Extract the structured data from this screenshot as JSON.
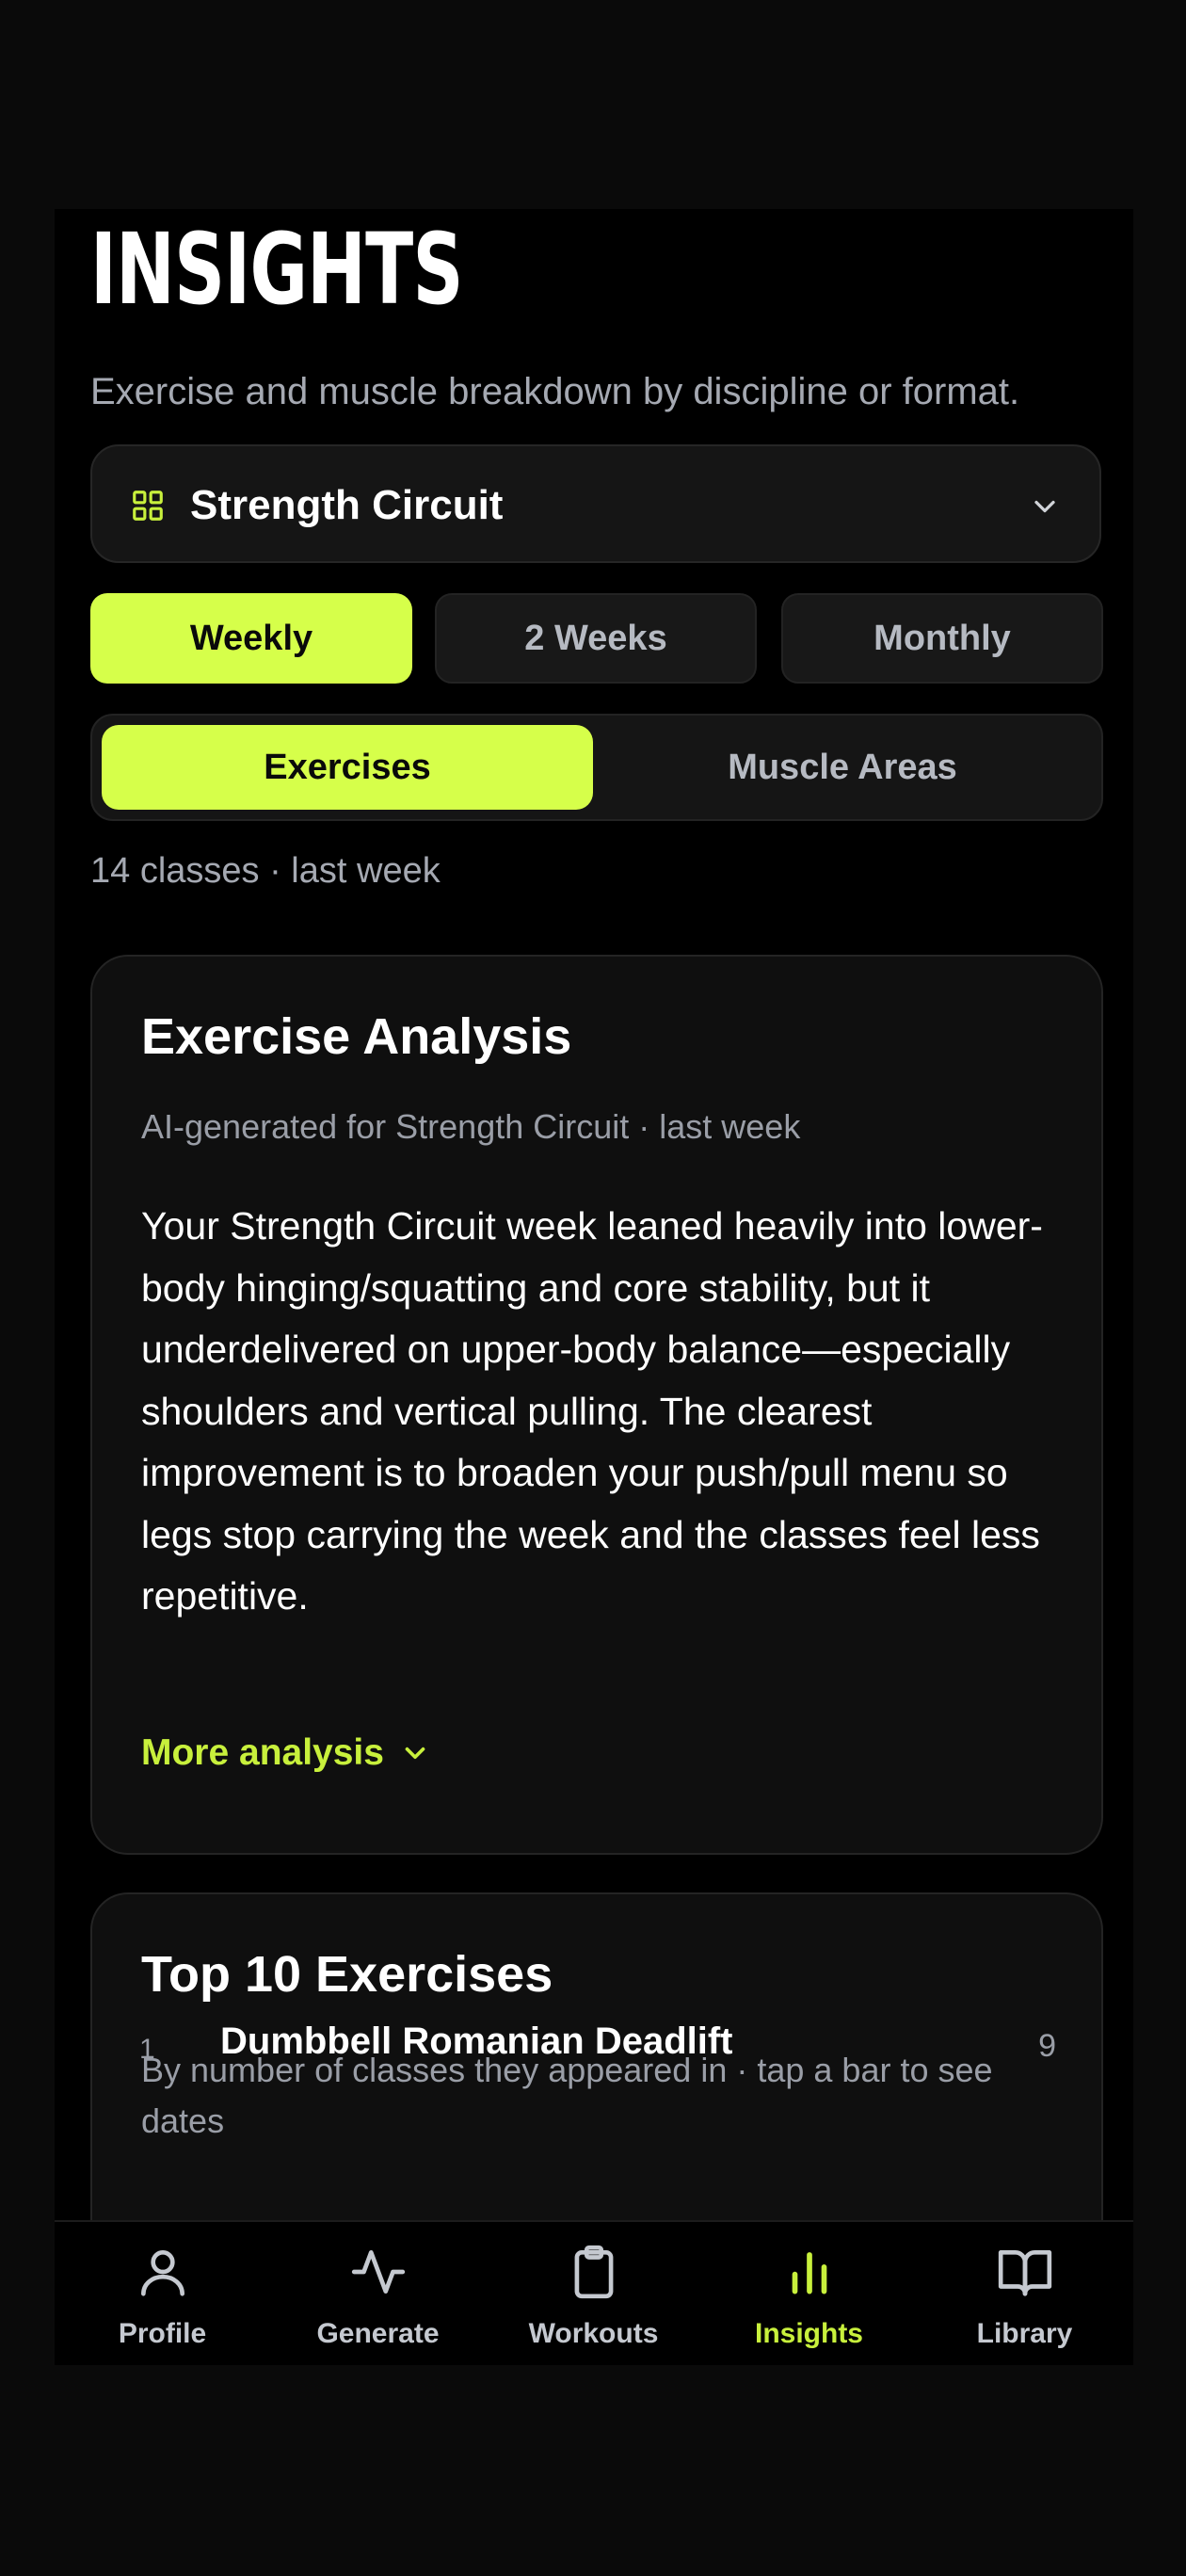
{
  "page": {
    "title": "INSIGHTS",
    "subtitle": "Exercise and muscle breakdown by discipline or format."
  },
  "discipline_select": {
    "icon": "grid-icon",
    "selected": "Strength Circuit",
    "chevron_icon": "chevron-down-icon"
  },
  "period_tabs": [
    {
      "label": "Weekly",
      "active": true
    },
    {
      "label": "2 Weeks",
      "active": false
    },
    {
      "label": "Monthly",
      "active": false
    }
  ],
  "view_toggle": [
    {
      "label": "Exercises",
      "active": true
    },
    {
      "label": "Muscle Areas",
      "active": false
    }
  ],
  "classes_info": "14 classes · last week",
  "analysis_card": {
    "title": "Exercise Analysis",
    "subtitle": "AI-generated for Strength Circuit · last week",
    "body": "Your Strength Circuit week leaned heavily into lower-body hinging/squatting and core stability, but it underdelivered on upper-body balance—especially shoulders and vertical pulling. The clearest improvement is to broaden your push/pull menu so legs stop carrying the week and the classes feel less repetitive.",
    "more_label": "More analysis"
  },
  "top_exercises_card": {
    "title": "Top 10 Exercises",
    "subtitle": "By number of classes they appeared in · tap a bar to see dates",
    "first_row": {
      "rank": "1",
      "label": "Dumbbell Romanian Deadlift",
      "count": "9"
    }
  },
  "bottom_nav": [
    {
      "label": "Profile",
      "icon": "person-icon",
      "active": false
    },
    {
      "label": "Generate",
      "icon": "activity-icon",
      "active": false
    },
    {
      "label": "Workouts",
      "icon": "clipboard-icon",
      "active": false
    },
    {
      "label": "Insights",
      "icon": "bar-chart-icon",
      "active": true
    },
    {
      "label": "Library",
      "icon": "book-icon",
      "active": false
    }
  ],
  "colors": {
    "accent": "#d6ff4a",
    "accent_text": "#c8f03c",
    "background": "#000000",
    "card": "#0f0f0f",
    "muted_text": "#a5a9b2"
  }
}
